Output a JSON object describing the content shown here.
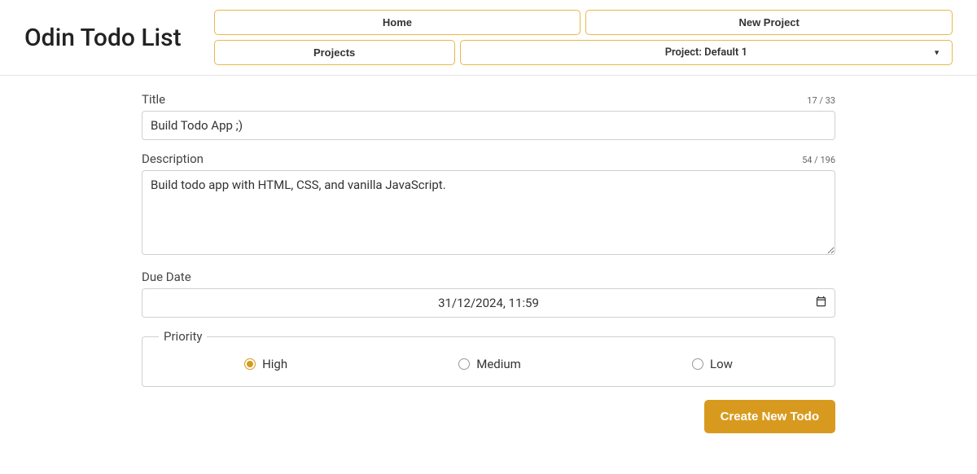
{
  "header": {
    "app_title": "Odin Todo List",
    "home_label": "Home",
    "new_project_label": "New Project",
    "projects_label": "Projects",
    "project_select_label": "Project: Default 1"
  },
  "form": {
    "title": {
      "label": "Title",
      "value": "Build Todo App ;)",
      "counter": "17 / 33"
    },
    "description": {
      "label": "Description",
      "value": "Build todo app with HTML, CSS, and vanilla JavaScript.",
      "counter": "54 / 196"
    },
    "due_date": {
      "label": "Due Date",
      "value": "31/12/2024, 11:59"
    },
    "priority": {
      "legend": "Priority",
      "options": {
        "high": "High",
        "medium": "Medium",
        "low": "Low"
      },
      "selected": "high"
    },
    "submit_label": "Create New Todo"
  }
}
